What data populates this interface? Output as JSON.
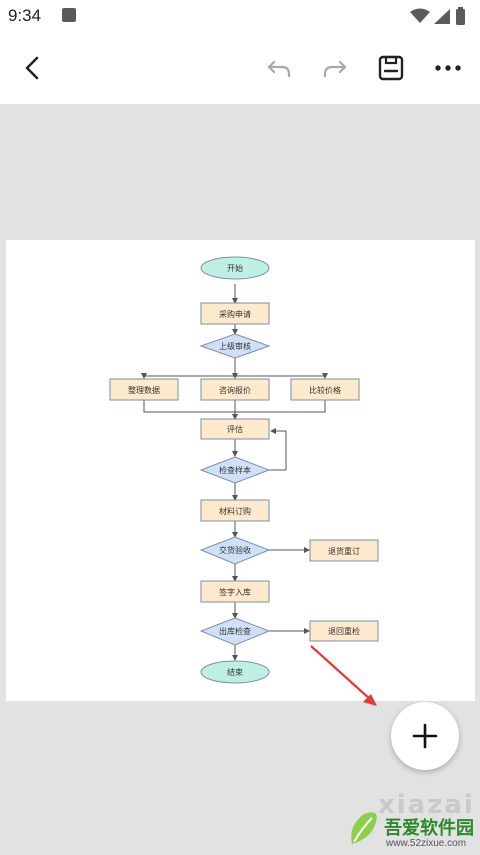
{
  "status_bar": {
    "time": "9:34"
  },
  "toolbar": {
    "back_icon": "arrow-left-icon",
    "undo_icon": "undo-icon",
    "redo_icon": "redo-icon",
    "save_icon": "save-icon",
    "more_icon": "more-horizontal-icon"
  },
  "flowchart": {
    "nodes": {
      "start": "开始",
      "purchase_request": "采购申请",
      "review": "上级审核",
      "collect_data": "整理数据",
      "inquiry": "咨询报价",
      "compare": "比较价格",
      "evaluate": "评估",
      "inspect_sample": "检查样本",
      "order_material": "材料订购",
      "delivery_check": "交货验收",
      "return_reorder": "退货重订",
      "sign_storage": "签字入库",
      "outbound_check": "出库检查",
      "return_recheck": "退回重检",
      "end": "结束"
    },
    "colors": {
      "terminal": "#bfeee3",
      "process": "#fde9cc",
      "decision": "#cfe0f7",
      "border": "#7a8fa8",
      "arrow": "#555555"
    }
  },
  "fab": {
    "icon": "plus-icon"
  },
  "annotation": {
    "color": "#e53935"
  },
  "watermark": {
    "text": "吾爱软件园",
    "url": "www.52zixue.com",
    "letters": "xiazai"
  }
}
